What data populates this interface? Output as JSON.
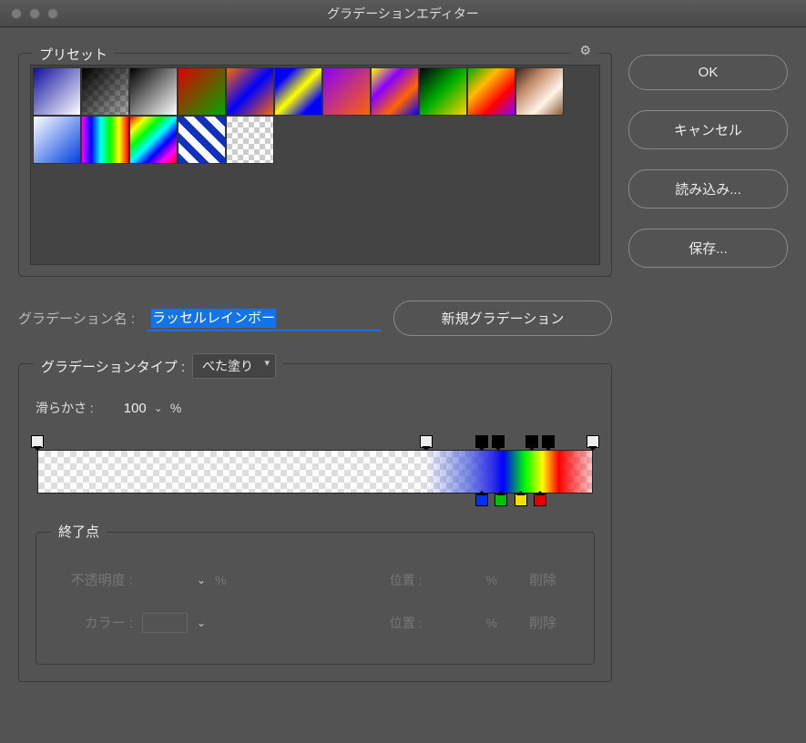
{
  "window": {
    "title": "グラデーションエディター"
  },
  "buttons": {
    "ok": "OK",
    "cancel": "キャンセル",
    "load": "読み込み...",
    "save": "保存...",
    "new_gradient": "新規グラデーション",
    "delete": "削除"
  },
  "presets": {
    "label": "プリセット",
    "gear": "⚙"
  },
  "name": {
    "label": "グラデーション名 :",
    "value": "ラッセルレインボー"
  },
  "type": {
    "label": "グラデーションタイプ :",
    "value": "べた塗り",
    "smoothness_label": "滑らかさ :",
    "smoothness_value": "100",
    "percent": "%"
  },
  "endpoint": {
    "label": "終了点",
    "opacity_label": "不透明度 :",
    "color_label": "カラー :",
    "position_label": "位置 :",
    "opacity_value": "",
    "position_value": ""
  },
  "opacity_stops": [
    {
      "pos": 0,
      "tone": "white"
    },
    {
      "pos": 70,
      "tone": "white"
    },
    {
      "pos": 80,
      "tone": "black"
    },
    {
      "pos": 83,
      "tone": "black"
    },
    {
      "pos": 89,
      "tone": "black"
    },
    {
      "pos": 92,
      "tone": "black"
    },
    {
      "pos": 100,
      "tone": "white"
    }
  ],
  "color_stops": [
    {
      "pos": 80,
      "color": "blue"
    },
    {
      "pos": 83.5,
      "color": "green"
    },
    {
      "pos": 87,
      "color": "yellow"
    },
    {
      "pos": 90.5,
      "color": "red"
    }
  ]
}
